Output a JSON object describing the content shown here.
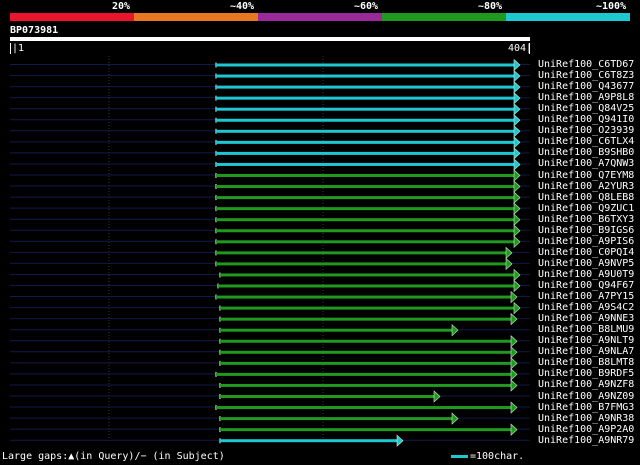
{
  "legend": {
    "ticks": [
      "20%",
      "~40%",
      "~60%",
      "~80%",
      "~100%"
    ],
    "colors": [
      "#e8152c",
      "#e87722",
      "#9a2a9a",
      "#1f9a1f",
      "#1ec8d2"
    ]
  },
  "query": {
    "name": "BP073981",
    "start": "|1",
    "end": "404|"
  },
  "hits": [
    {
      "label": "UniRef100_C6TD67",
      "color": "cyan",
      "start": 216,
      "end": 520
    },
    {
      "label": "UniRef100_C6T8Z3",
      "color": "cyan",
      "start": 216,
      "end": 520
    },
    {
      "label": "UniRef100_Q43677",
      "color": "cyan",
      "start": 216,
      "end": 520
    },
    {
      "label": "UniRef100_A9P8L8",
      "color": "cyan",
      "start": 216,
      "end": 520
    },
    {
      "label": "UniRef100_Q84V25",
      "color": "cyan",
      "start": 216,
      "end": 520
    },
    {
      "label": "UniRef100_Q941I0",
      "color": "cyan",
      "start": 216,
      "end": 520
    },
    {
      "label": "UniRef100_O23939",
      "color": "cyan",
      "start": 216,
      "end": 520
    },
    {
      "label": "UniRef100_C6TLX4",
      "color": "cyan",
      "start": 216,
      "end": 520
    },
    {
      "label": "UniRef100_B9SHB0",
      "color": "cyan",
      "start": 216,
      "end": 520
    },
    {
      "label": "UniRef100_A7QNW3",
      "color": "cyan",
      "start": 216,
      "end": 520
    },
    {
      "label": "UniRef100_Q7EYM8",
      "color": "green",
      "start": 216,
      "end": 520
    },
    {
      "label": "UniRef100_A2YUR3",
      "color": "green",
      "start": 216,
      "end": 520
    },
    {
      "label": "UniRef100_Q8LEB8",
      "color": "green",
      "start": 216,
      "end": 520
    },
    {
      "label": "UniRef100_Q9ZUC1",
      "color": "green",
      "start": 216,
      "end": 520
    },
    {
      "label": "UniRef100_B6TXY3",
      "color": "green",
      "start": 216,
      "end": 520
    },
    {
      "label": "UniRef100_B9IGS6",
      "color": "green",
      "start": 216,
      "end": 520
    },
    {
      "label": "UniRef100_A9PIS6",
      "color": "green",
      "start": 216,
      "end": 520
    },
    {
      "label": "UniRef100_C0PQI4",
      "color": "green",
      "start": 216,
      "end": 512
    },
    {
      "label": "UniRef100_A9NVP5",
      "color": "green",
      "start": 216,
      "end": 512
    },
    {
      "label": "UniRef100_A9U0T9",
      "color": "green",
      "start": 220,
      "end": 520
    },
    {
      "label": "UniRef100_Q94F67",
      "color": "green",
      "start": 218,
      "end": 520
    },
    {
      "label": "UniRef100_A7PY15",
      "color": "green",
      "start": 216,
      "end": 517
    },
    {
      "label": "UniRef100_A9S4C2",
      "color": "green",
      "start": 220,
      "end": 520
    },
    {
      "label": "UniRef100_A9NNE3",
      "color": "green",
      "start": 220,
      "end": 517
    },
    {
      "label": "UniRef100_B8LMU9",
      "color": "green",
      "start": 220,
      "end": 458
    },
    {
      "label": "UniRef100_A9NLT9",
      "color": "green",
      "start": 220,
      "end": 517
    },
    {
      "label": "UniRef100_A9NLA7",
      "color": "green",
      "start": 220,
      "end": 517
    },
    {
      "label": "UniRef100_B8LMT8",
      "color": "green",
      "start": 220,
      "end": 517
    },
    {
      "label": "UniRef100_B9RDF5",
      "color": "green",
      "start": 216,
      "end": 517
    },
    {
      "label": "UniRef100_A9NZF8",
      "color": "green",
      "start": 220,
      "end": 517
    },
    {
      "label": "UniRef100_A9NZ09",
      "color": "green",
      "start": 220,
      "end": 440
    },
    {
      "label": "UniRef100_B7FMG3",
      "color": "green",
      "start": 216,
      "end": 517
    },
    {
      "label": "UniRef100_A9NR38",
      "color": "green",
      "start": 220,
      "end": 458
    },
    {
      "label": "UniRef100_A9P2A0",
      "color": "green",
      "start": 220,
      "end": 517
    },
    {
      "label": "UniRef100_A9NR79",
      "color": "cyan",
      "start": 220,
      "end": 403
    }
  ],
  "footer": {
    "gaps_text": "Large gaps:▲(in Query)/− (in Subject)",
    "scale_text": "=100char."
  }
}
